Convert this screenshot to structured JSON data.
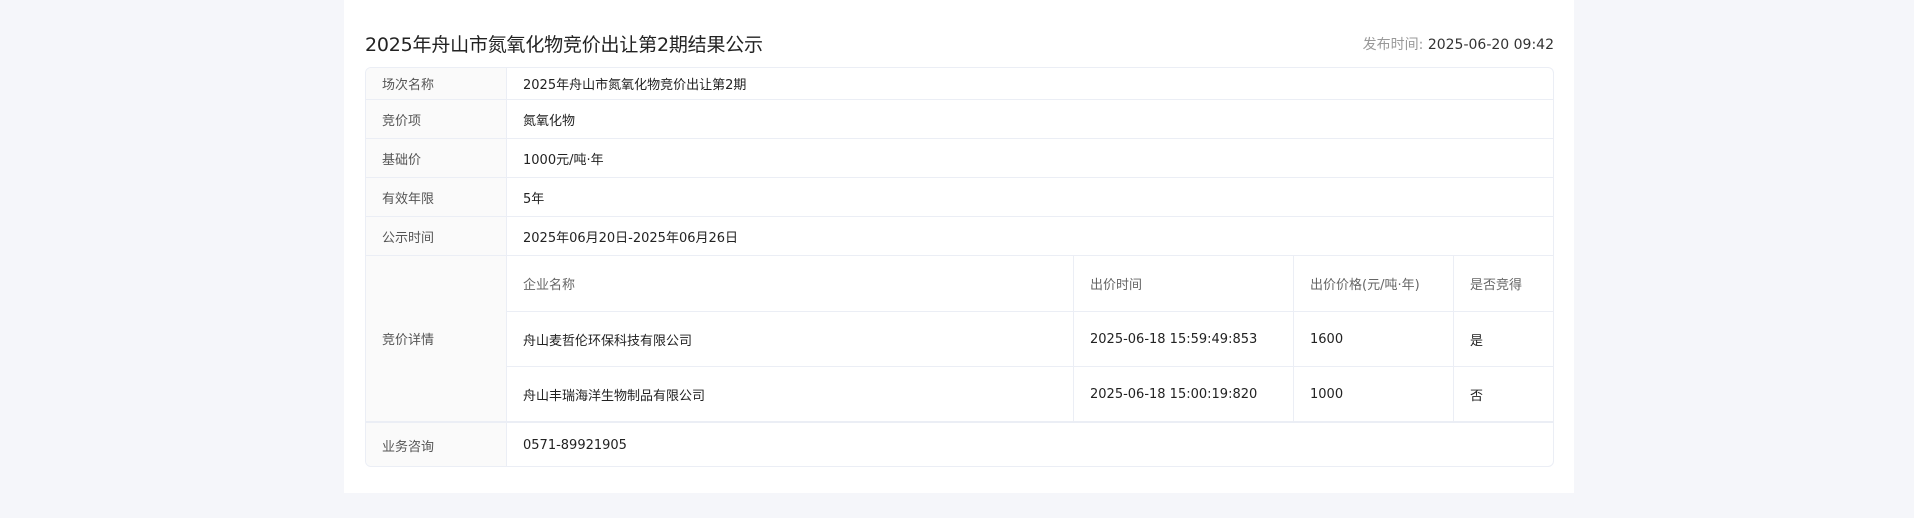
{
  "header": {
    "title": "2025年舟山市氮氧化物竞价出让第2期结果公示",
    "publish_label": "发布时间:",
    "publish_time": "2025-06-20 09:42"
  },
  "info_rows": [
    {
      "label": "场次名称",
      "value": "2025年舟山市氮氧化物竞价出让第2期"
    },
    {
      "label": "竞价项",
      "value": "氮氧化物"
    },
    {
      "label": "基础价",
      "value": "1000元/吨·年"
    },
    {
      "label": "有效年限",
      "value": "5年"
    },
    {
      "label": "公示时间",
      "value": "2025年06月20日-2025年06月26日"
    }
  ],
  "bid_details": {
    "label": "竞价详情",
    "columns": [
      "企业名称",
      "出价时间",
      "出价价格(元/吨·年)",
      "是否竞得"
    ],
    "rows": [
      [
        "舟山麦哲伦环保科技有限公司",
        "2025-06-18 15:59:49:853",
        "1600",
        "是"
      ],
      [
        "舟山丰瑞海洋生物制品有限公司",
        "2025-06-18 15:00:19:820",
        "1000",
        "否"
      ]
    ]
  },
  "consult": {
    "label": "业务咨询",
    "value": "0571-89921905"
  }
}
